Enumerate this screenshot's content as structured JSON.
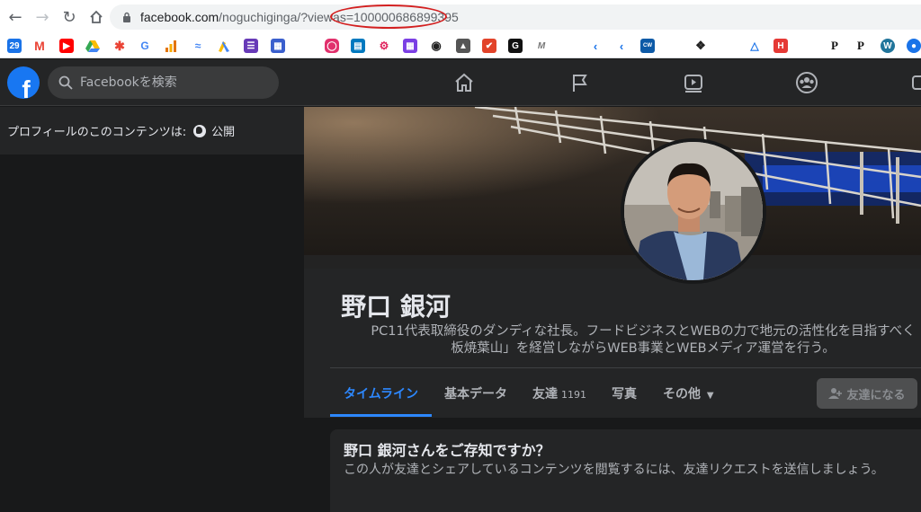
{
  "browser": {
    "url_host": "facebook.com",
    "url_path": "/noguchiginga/?viewas=100000686899395"
  },
  "facebook": {
    "logo_letter": "f",
    "search_placeholder": "Facebookを検索",
    "privacy_label": "プロフィールのこのコンテンツは:",
    "privacy_value": "公開",
    "profile": {
      "name": "野口 銀河",
      "bio_line1": "PC11代表取締役のダンディな社長。フードビジネスとWEBの力で地元の活性化を目指すべく",
      "bio_line2": "板焼葉山」を経営しながらWEB事業とWEBメディア運営を行う。"
    },
    "tabs": [
      {
        "label": "タイムライン"
      },
      {
        "label": "基本データ"
      },
      {
        "label": "友達",
        "count": "1191"
      },
      {
        "label": "写真"
      },
      {
        "label": "その他"
      }
    ],
    "add_friend_label": "友達になる",
    "know_card": {
      "title": "野口 銀河さんをご存知ですか？",
      "description": "この人が友達とシェアしているコンテンツを閲覧するには、友達リクエストを送信しましょう。"
    }
  }
}
